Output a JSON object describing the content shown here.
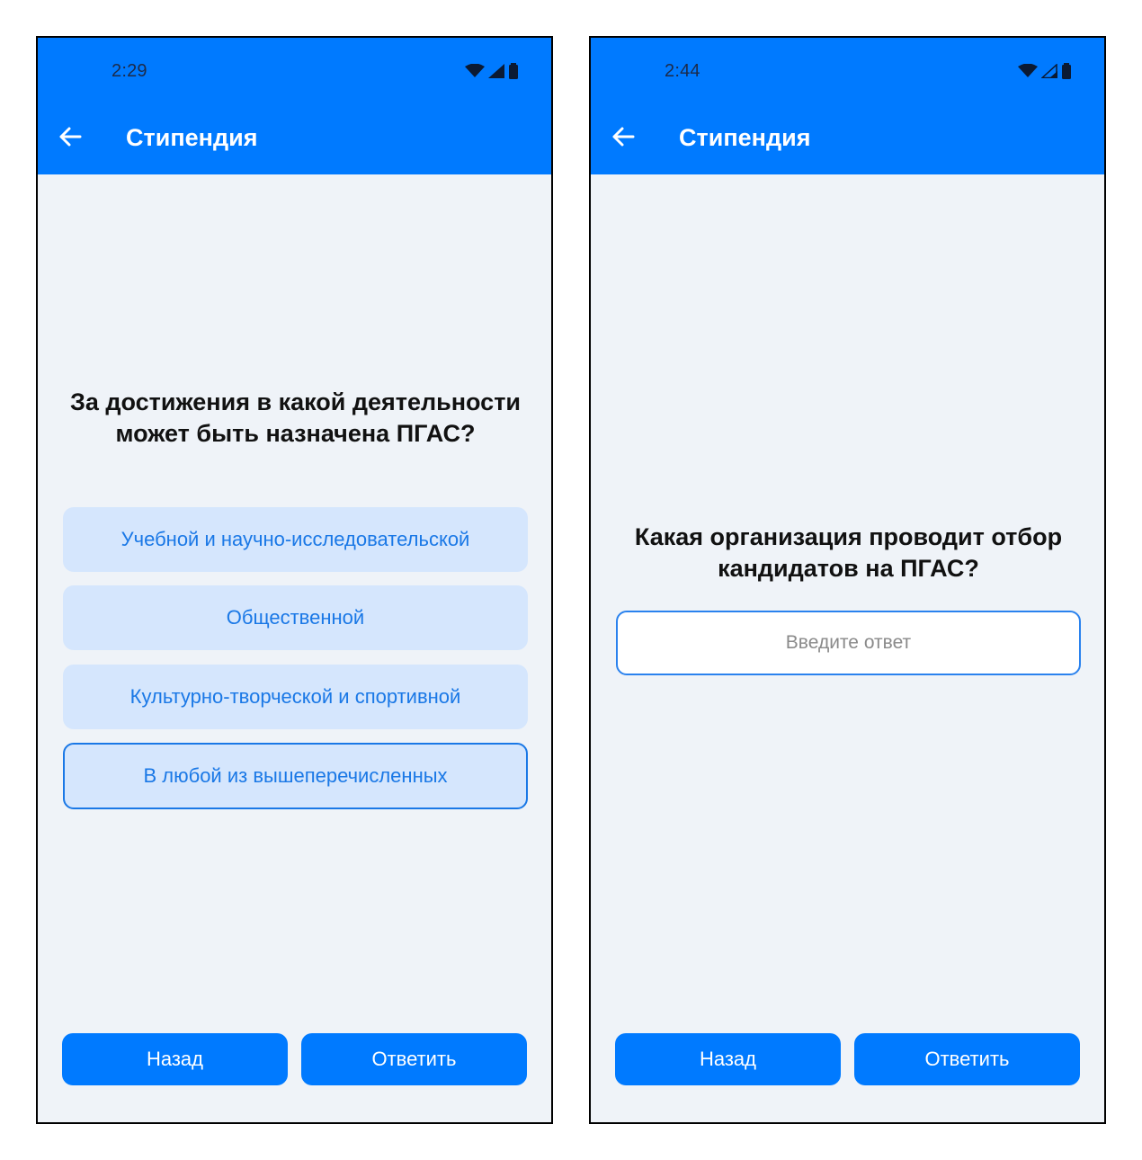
{
  "colors": {
    "primary": "#007aff",
    "background": "#eff3f8",
    "option_bg": "#d5e6fd",
    "option_text": "#1a78e6"
  },
  "left_screen": {
    "status_bar": {
      "time": "2:29",
      "icons": [
        "wifi-icon",
        "signal-icon",
        "battery-icon"
      ]
    },
    "app_bar": {
      "title": "Стипендия",
      "back_icon": "arrow-left-icon"
    },
    "question": "За достижения в какой деятельности может быть назначена ПГАС?",
    "options": [
      {
        "label": "Учебной и научно-исследовательской",
        "selected": false
      },
      {
        "label": "Общественной",
        "selected": false
      },
      {
        "label": "Культурно-творческой и спортивной",
        "selected": false
      },
      {
        "label": "В любой из вышеперечисленных",
        "selected": true
      }
    ],
    "buttons": {
      "back": "Назад",
      "submit": "Ответить"
    }
  },
  "right_screen": {
    "status_bar": {
      "time": "2:44",
      "icons": [
        "wifi-icon",
        "signal-icon",
        "battery-icon"
      ]
    },
    "app_bar": {
      "title": "Стипендия",
      "back_icon": "arrow-left-icon"
    },
    "question": "Какая организация проводит отбор кандидатов на ПГАС?",
    "answer_input": {
      "value": "",
      "placeholder": "Введите ответ"
    },
    "buttons": {
      "back": "Назад",
      "submit": "Ответить"
    }
  }
}
